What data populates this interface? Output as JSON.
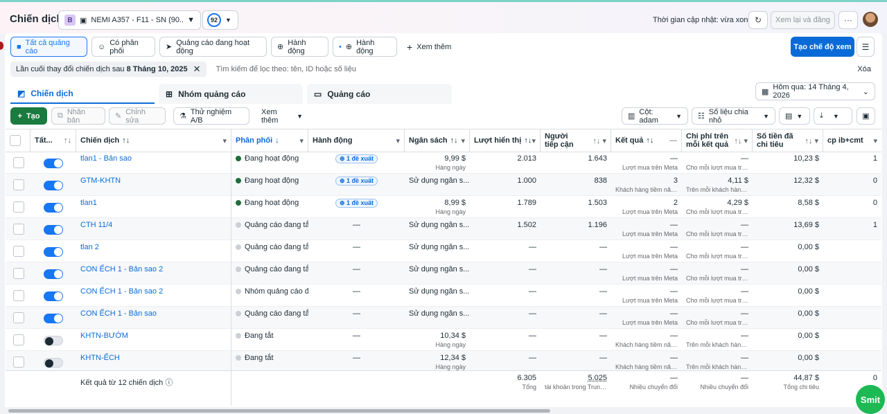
{
  "header": {
    "title": "Chiến dịch",
    "account_badge": "B",
    "account_name": "NEMI A357 - F11 - SN (90...",
    "score": "92",
    "updated_label": "Thời gian cập nhật: vừa xong",
    "review_label": "Xem lại và đăng",
    "more_label": "···"
  },
  "filters": {
    "items": [
      {
        "label": "Tất cả quảng cáo"
      },
      {
        "label": "Có phân phối"
      },
      {
        "label": "Quảng cáo đang hoạt động"
      },
      {
        "label": "Hành động"
      },
      {
        "label": "Hành động"
      }
    ],
    "more_label": "Xem thêm",
    "create_view_label": "Tạo chế độ xem"
  },
  "search": {
    "chip_prefix": "Lần cuối thay đổi chiến dịch sau ",
    "chip_value": "8 Tháng 10, 2025",
    "placeholder": "Tìm kiếm để lọc theo: tên, ID hoặc số liệu",
    "clear_label": "Xóa"
  },
  "tabs": [
    {
      "label": "Chiến dịch"
    },
    {
      "label": "Nhóm quảng cáo"
    },
    {
      "label": "Quảng cáo"
    }
  ],
  "date_range": "Hôm qua: 14 Tháng 4, 2026",
  "toolbar": {
    "create": "Tạo",
    "duplicate": "Nhân bản",
    "edit": "Chỉnh sửa",
    "ab_test": "Thử nghiệm A/B",
    "more": "Xem thêm",
    "columns": "Cột: adam",
    "breakdown": "Số liệu chia nhỏ"
  },
  "columns": [
    {
      "label": "Tất..."
    },
    {
      "label": "Chiến dịch"
    },
    {
      "label": "Phân phối"
    },
    {
      "label": "Hành động"
    },
    {
      "label": "Ngân sách"
    },
    {
      "label": "Lượt hiển thị"
    },
    {
      "label": "Người tiếp cận"
    },
    {
      "label": "Kết quả"
    },
    {
      "label": "Chi phí trên mỗi kết quả"
    },
    {
      "label": "Số tiền đã chi tiêu"
    },
    {
      "label": "cp ib+cmt"
    }
  ],
  "rows": [
    {
      "on": true,
      "name": "tlan1 - Bản sao",
      "delivery": "Đang hoạt động",
      "dgreen": true,
      "action": "1 đề xuất",
      "budget": "9,99 $",
      "budget_sub": "Hàng ngày",
      "impr": "2.013",
      "reach": "1.643",
      "result": "—",
      "result_sub": "Lượt mua trên Meta",
      "cpr": "—",
      "cpr_sub": "Cho mỗi lượt mua trên...",
      "spent": "10,23 $",
      "ib": "1"
    },
    {
      "on": true,
      "name": "GTM-KHTN",
      "delivery": "Đang hoạt động",
      "dgreen": true,
      "action": "1 đề xuất",
      "budget": "Sử dụng ngân s...",
      "budget_sub": "",
      "impr": "1.000",
      "reach": "838",
      "result": "3",
      "result_sub": "Khách hàng tiềm năng...",
      "cpr": "4,11 $",
      "cpr_sub": "Trên mỗi khách hàng t...",
      "spent": "12,32 $",
      "ib": "0"
    },
    {
      "on": true,
      "name": "tlan1",
      "delivery": "Đang hoạt động",
      "dgreen": true,
      "action": "1 đề xuất",
      "budget": "8,99 $",
      "budget_sub": "Hàng ngày",
      "impr": "1.789",
      "reach": "1.503",
      "result": "2",
      "result_sub": "Lượt mua trên Meta",
      "cpr": "4,29 $",
      "cpr_sub": "Cho mỗi lượt mua trên...",
      "spent": "8,58 $",
      "ib": "0"
    },
    {
      "on": true,
      "name": "CTH 11/4",
      "delivery": "Quảng cáo đang tắt",
      "dgreen": false,
      "action": "—",
      "budget": "Sử dụng ngân s...",
      "budget_sub": "",
      "impr": "1.502",
      "reach": "1.196",
      "result": "—",
      "result_sub": "Lượt mua trên Meta",
      "cpr": "—",
      "cpr_sub": "Cho mỗi lượt mua trên...",
      "spent": "13,69 $",
      "ib": "1"
    },
    {
      "on": true,
      "name": "tlan 2",
      "delivery": "Quảng cáo đang tắt",
      "dgreen": false,
      "action": "—",
      "budget": "Sử dụng ngân s...",
      "budget_sub": "",
      "impr": "—",
      "reach": "—",
      "result": "—",
      "result_sub": "Lượt mua trên Meta",
      "cpr": "—",
      "cpr_sub": "Cho mỗi lượt mua trên...",
      "spent": "0,00 $",
      "ib": ""
    },
    {
      "on": true,
      "name": "CON ẾCH 1 - Bản sao 2",
      "delivery": "Quảng cáo đang tắt",
      "dgreen": false,
      "action": "—",
      "budget": "Sử dụng ngân s...",
      "budget_sub": "",
      "impr": "—",
      "reach": "—",
      "result": "—",
      "result_sub": "Lượt mua trên Meta",
      "cpr": "—",
      "cpr_sub": "Cho mỗi lượt mua trên...",
      "spent": "0,00 $",
      "ib": ""
    },
    {
      "on": true,
      "name": "CON ẾCH 1 - Bản sao 2",
      "delivery": "Nhóm quảng cáo đa",
      "dgreen": false,
      "action": "—",
      "budget": "Sử dụng ngân s...",
      "budget_sub": "",
      "impr": "—",
      "reach": "—",
      "result": "—",
      "result_sub": "Lượt mua trên Meta",
      "cpr": "—",
      "cpr_sub": "Cho mỗi lượt mua trên...",
      "spent": "0,00 $",
      "ib": ""
    },
    {
      "on": true,
      "name": "CON ẾCH 1 - Bản sao",
      "delivery": "Quảng cáo đang tắt",
      "dgreen": false,
      "action": "—",
      "budget": "Sử dụng ngân s...",
      "budget_sub": "",
      "impr": "—",
      "reach": "—",
      "result": "—",
      "result_sub": "Lượt mua trên Meta",
      "cpr": "—",
      "cpr_sub": "Cho mỗi lượt mua trên...",
      "spent": "0,00 $",
      "ib": ""
    },
    {
      "on": false,
      "name": "KHTN-BƯỚM",
      "delivery": "Đang tắt",
      "dgreen": false,
      "action": "—",
      "budget": "10,34 $",
      "budget_sub": "Hàng ngày",
      "impr": "—",
      "reach": "—",
      "result": "—",
      "result_sub": "Khách hàng tiềm năng...",
      "cpr": "—",
      "cpr_sub": "Trên mỗi khách hàng t...",
      "spent": "0,00 $",
      "ib": ""
    },
    {
      "on": false,
      "name": "KHTN-ẾCH",
      "delivery": "Đang tắt",
      "dgreen": false,
      "action": "—",
      "budget": "12,34 $",
      "budget_sub": "Hàng ngày",
      "impr": "—",
      "reach": "—",
      "result": "—",
      "result_sub": "Khách hàng tiềm năng...",
      "cpr": "—",
      "cpr_sub": "Trên mỗi khách hàng t...",
      "spent": "0,00 $",
      "ib": ""
    }
  ],
  "totals": {
    "label": "Kết quả từ 12 chiến dịch",
    "impr": "6.305",
    "impr_sub": "Tổng",
    "reach": "5.025",
    "reach_sub": "tài khoản trong Trung ...",
    "result": "—",
    "result_sub": "Nhiều chuyển đổi",
    "cpr": "—",
    "cpr_sub": "Nhiều chuyển đổi",
    "spent": "44,87 $",
    "spent_sub": "Tổng chi tiêu",
    "ib": "0"
  },
  "widget": {
    "label": "Smit"
  }
}
